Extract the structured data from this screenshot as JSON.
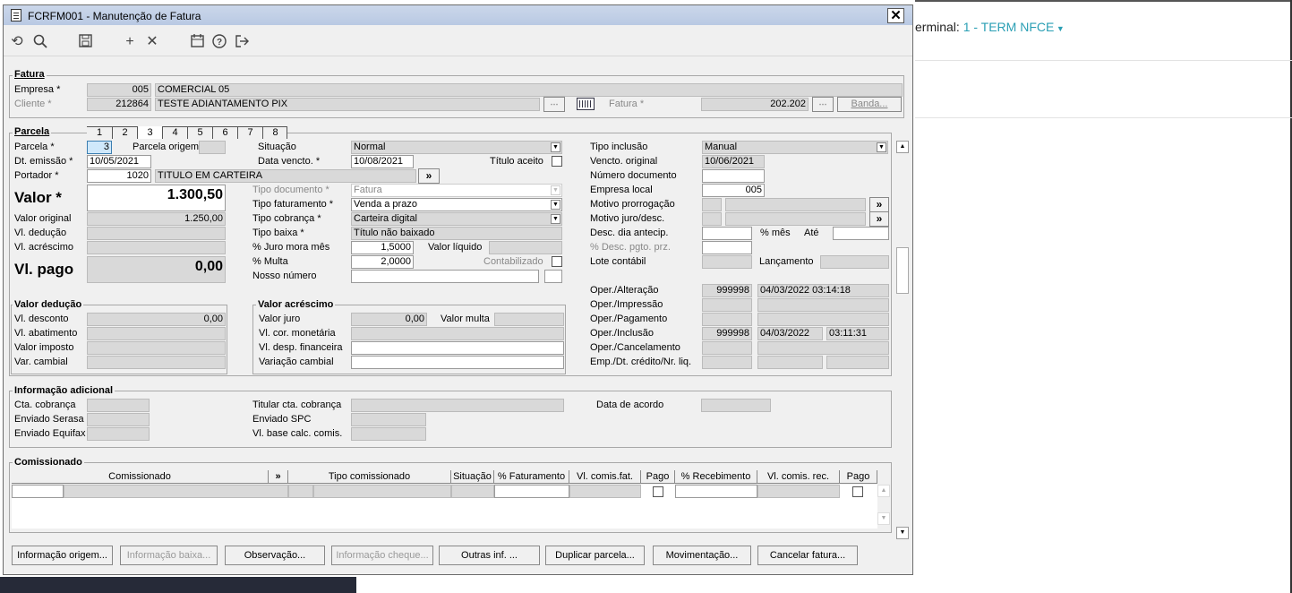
{
  "background": {
    "terminal_label": "erminal:",
    "terminal_value": "1 - TERM NFCE"
  },
  "window": {
    "title": "FCRFM001 - Manutenção de Fatura",
    "close": "✕"
  },
  "toolbar": {
    "undo": "⟲",
    "search": "🔍",
    "save": "🖫",
    "add": "+",
    "remove": "✕",
    "calendar": "📅",
    "help": "?",
    "exit": "⇥"
  },
  "fatura": {
    "title": "Fatura",
    "empresa_label": "Empresa *",
    "empresa_code": "005",
    "empresa_name": "COMERCIAL 05",
    "cliente_label": "Cliente *",
    "cliente_code": "212864",
    "cliente_name": "TESTE ADIANTAMENTO PIX",
    "fatura_label": "Fatura *",
    "fatura_value": "202.202",
    "banda_label": "Banda..."
  },
  "parcela": {
    "title": "Parcela",
    "tabs": [
      "1",
      "2",
      "3",
      "4",
      "5",
      "6",
      "7",
      "8"
    ],
    "parcela_label": "Parcela *",
    "parcela_value": "3",
    "origem_label": "Parcela origem",
    "emissao_label": "Dt. emissão *",
    "emissao_value": "10/05/2021",
    "portador_label": "Portador *",
    "portador_code": "1020",
    "portador_name": "TITULO EM CARTEIRA",
    "valor_label": "Valor *",
    "valor_value": "1.300,50",
    "valor_original_label": "Valor original",
    "valor_original_value": "1.250,00",
    "deducao_label": "Vl. dedução",
    "acrescimo_label": "Vl. acréscimo",
    "pago_label": "Vl. pago",
    "pago_value": "0,00",
    "situacao_label": "Situação",
    "situacao_value": "Normal",
    "vencto_label": "Data vencto. *",
    "vencto_value": "10/08/2021",
    "aceito_label": "Título aceito",
    "tipo_doc_label": "Tipo documento *",
    "tipo_doc_value": "Fatura",
    "tipo_fat_label": "Tipo faturamento *",
    "tipo_fat_value": "Venda a prazo",
    "tipo_cob_label": "Tipo cobrança *",
    "tipo_cob_value": "Carteira digital",
    "tipo_baixa_label": "Tipo baixa *",
    "tipo_baixa_value": "Título não baixado",
    "juro_label": "% Juro mora mês",
    "juro_value": "1,5000",
    "liquido_label": "Valor líquido",
    "multa_label": "% Multa",
    "multa_value": "2,0000",
    "contab_label": "Contabilizado",
    "nosso_label": "Nosso número",
    "tipo_incl_label": "Tipo inclusão",
    "tipo_incl_value": "Manual",
    "venc_orig_label": "Vencto. original",
    "venc_orig_value": "10/06/2021",
    "num_doc_label": "Número documento",
    "emp_local_label": "Empresa local",
    "emp_local_value": "005",
    "prorrog_label": "Motivo prorrogação",
    "juro_desc_label": "Motivo juro/desc.",
    "desc_antecip_label": "Desc. dia antecip.",
    "pct_mes_label": "% mês",
    "ate_label": "Até",
    "desc_pgto_label": "% Desc. pgto. prz.",
    "lote_label": "Lote contábil",
    "lancamento_label": "Lançamento",
    "oper_alt_label": "Oper./Alteração",
    "oper_alt_user": "999998",
    "oper_alt_date": "04/03/2022 03:14:18",
    "oper_imp_label": "Oper./Impressão",
    "oper_pag_label": "Oper./Pagamento",
    "oper_inc_label": "Oper./Inclusão",
    "oper_inc_user": "999998",
    "oper_inc_date": "04/03/2022",
    "oper_inc_time": "03:11:31",
    "oper_canc_label": "Oper./Cancelamento",
    "emp_dt_label": "Emp./Dt. crédito/Nr. liq."
  },
  "deducao": {
    "title": "Valor dedução",
    "desconto_label": "Vl. desconto",
    "desconto_value": "0,00",
    "abatimento_label": "Vl. abatimento",
    "imposto_label": "Valor imposto",
    "cambial_label": "Var. cambial"
  },
  "acrescimo": {
    "title": "Valor acréscimo",
    "juro_label": "Valor juro",
    "juro_value": "0,00",
    "multa_label": "Valor multa",
    "cor_label": "Vl. cor. monetária",
    "desp_label": "Vl. desp. financeira",
    "var_label": "Variação cambial"
  },
  "info": {
    "title": "Informação adicional",
    "cta_label": "Cta. cobrança",
    "serasa_label": "Enviado Serasa",
    "equifax_label": "Enviado Equifax",
    "titular_label": "Titular cta. cobrança",
    "spc_label": "Enviado SPC",
    "base_label": "Vl. base calc. comis.",
    "acordo_label": "Data de acordo"
  },
  "comissionado": {
    "title": "Comissionado",
    "columns": [
      "Comissionado",
      "»",
      "Tipo comissionado",
      "Situação",
      "% Faturamento",
      "Vl. comis.fat.",
      "Pago",
      "% Recebimento",
      "Vl. comis. rec.",
      "Pago"
    ]
  },
  "buttons": {
    "origem": "Informação origem...",
    "baixa": "Informação baixa...",
    "observacao": "Observação...",
    "cheque": "Informação cheque...",
    "outras": "Outras inf. ...",
    "duplicar": "Duplicar parcela...",
    "movimentacao": "Movimentação...",
    "cancelar": "Cancelar fatura..."
  },
  "misc": {
    "more": "»",
    "dots": "⋯",
    "down": "▼",
    "up": "▲"
  }
}
